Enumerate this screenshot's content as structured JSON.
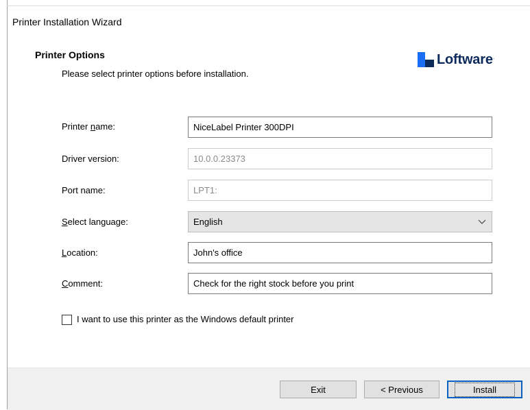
{
  "window": {
    "title": "Printer Installation Wizard"
  },
  "header": {
    "title": "Printer Options",
    "subtitle": "Please select printer options before installation.",
    "logo_text": "Loftware",
    "logo_tm": "·"
  },
  "form": {
    "printer_name": {
      "label_pre": "Printer ",
      "label_ul": "n",
      "label_post": "ame:",
      "value": "NiceLabel Printer 300DPI"
    },
    "driver_version": {
      "label": "Driver version:",
      "value": "10.0.0.23373"
    },
    "port_name": {
      "label": "Port name:",
      "value": "LPT1:"
    },
    "language": {
      "label_ul": "S",
      "label_post": "elect language:",
      "value": "English"
    },
    "location": {
      "label_ul": "L",
      "label_post": "ocation:",
      "value": "John's office"
    },
    "comment": {
      "label_ul": "C",
      "label_post": "omment:",
      "value": "Check for the right stock before you print"
    },
    "default_printer": {
      "label": "I want to use this printer as the Windows default printer",
      "checked": false
    }
  },
  "buttons": {
    "exit": "Exit",
    "previous": "< Previous",
    "install": "Install"
  },
  "colors": {
    "accent": "#0b5fbf",
    "logo_blue": "#1b6ef3",
    "logo_navy": "#0b2a5b"
  }
}
